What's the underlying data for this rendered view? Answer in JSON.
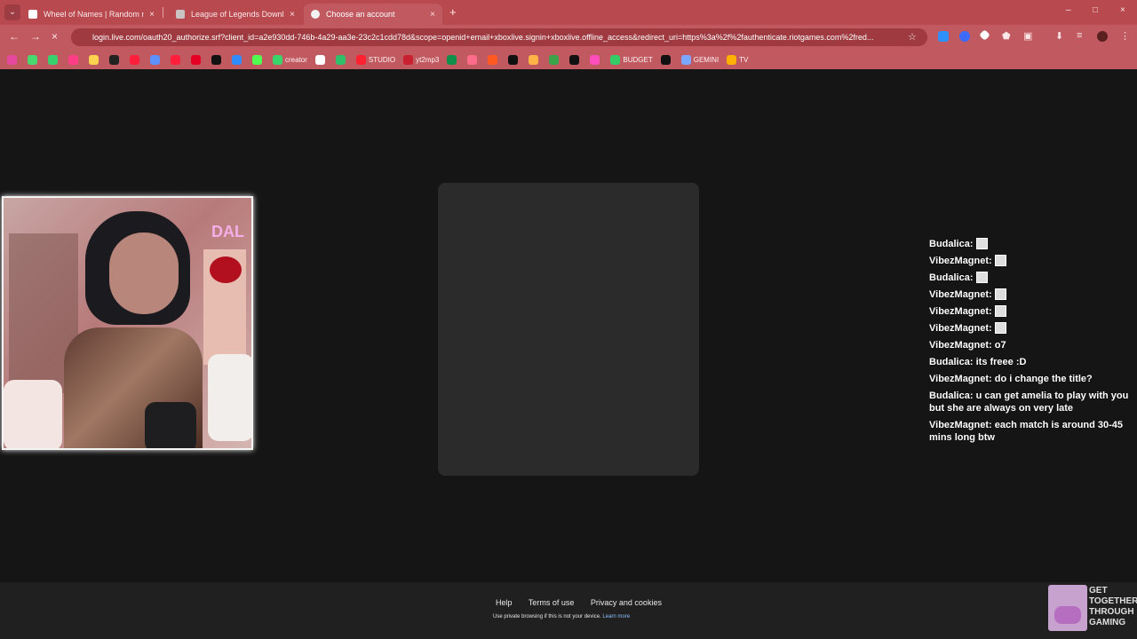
{
  "browser": {
    "tab_list_icon": "chevron-down-icon",
    "tabs": [
      {
        "title": "Wheel of Names | Random nam",
        "favicon_color": "#ffffff",
        "active": false
      },
      {
        "title": "League of Legends Download |",
        "favicon_color": "#c9c3c4",
        "active": false
      },
      {
        "title": "Choose an account",
        "favicon_color": "#f2f2f2",
        "active": true
      }
    ],
    "new_tab_symbol": "+",
    "window_controls": {
      "minimize": "–",
      "maximize": "□",
      "close": "×"
    },
    "toolbar": {
      "back_symbol": "←",
      "forward_symbol": "→",
      "stop_symbol": "×",
      "address": "login.live.com/oauth20_authorize.srf?client_id=a2e930dd-746b-4a29-aa3e-23c2c1cdd78d&scope=openid+email+xboxlive.signin+xboxlive.offline_access&redirect_uri=https%3a%2f%2fauthenticate.riotgames.com%2fred...",
      "site_icon": "tune-icon",
      "bookmark_star": "☆",
      "extensions_icon": "puzzle-icon",
      "downloads_icon": "download-icon",
      "media_icon": "media-icon",
      "profile_icon": "profile-icon",
      "menu_icon": "⋮"
    },
    "bookmarks": [
      {
        "label": "",
        "color": "#e6489f"
      },
      {
        "label": "",
        "color": "#47d86f"
      },
      {
        "label": "",
        "color": "#36d16d"
      },
      {
        "label": "",
        "color": "#ff3d86"
      },
      {
        "label": "",
        "color": "#ffd34e"
      },
      {
        "label": "",
        "color": "#222222"
      },
      {
        "label": "",
        "color": "#ff1f3d"
      },
      {
        "label": "",
        "color": "#5c91ff"
      },
      {
        "label": "",
        "color": "#ff1f3d"
      },
      {
        "label": "",
        "color": "#e60023"
      },
      {
        "label": "",
        "color": "#111111"
      },
      {
        "label": "",
        "color": "#2e8cff"
      },
      {
        "label": "",
        "color": "#50ff50"
      },
      {
        "label": "creator",
        "color": "#39d46a"
      },
      {
        "label": "",
        "color": "#ffffff"
      },
      {
        "label": "",
        "color": "#2fbf68"
      },
      {
        "label": "STUDIO",
        "color": "#ff2030"
      },
      {
        "label": "yt2mp3",
        "color": "#c91f2f"
      },
      {
        "label": "",
        "color": "#0f8f4a"
      },
      {
        "label": "",
        "color": "#ff6b8b"
      },
      {
        "label": "",
        "color": "#ff5a1f"
      },
      {
        "label": "",
        "color": "#111111"
      },
      {
        "label": "",
        "color": "#ffb347"
      },
      {
        "label": "",
        "color": "#3ca34b"
      },
      {
        "label": "",
        "color": "#111111"
      },
      {
        "label": "",
        "color": "#ff4dbb"
      },
      {
        "label": "BUDGET",
        "color": "#33cc66"
      },
      {
        "label": "",
        "color": "#111111"
      },
      {
        "label": "GEMINI",
        "color": "#7aa7ff"
      },
      {
        "label": "TV",
        "color": "#ffb000"
      }
    ]
  },
  "overlay": {
    "camera_label": "DAL",
    "chat": [
      {
        "user": "Budalica",
        "message": "",
        "emote": "emote-icon"
      },
      {
        "user": "VibezMagnet",
        "message": "",
        "emote": "emote-icon"
      },
      {
        "user": "Budalica",
        "message": "",
        "emote": "emote-icon"
      },
      {
        "user": "VibezMagnet",
        "message": "",
        "emote": "emote-icon"
      },
      {
        "user": "VibezMagnet",
        "message": "",
        "emote": "emote-icon"
      },
      {
        "user": "VibezMagnet",
        "message": "",
        "emote": "emote-icon"
      },
      {
        "user": "VibezMagnet",
        "message": "o7",
        "emote": ""
      },
      {
        "user": "Budalica",
        "message": "its freee :D",
        "emote": ""
      },
      {
        "user": "VibezMagnet",
        "message": "do i change the title?",
        "emote": ""
      },
      {
        "user": "Budalica",
        "message": "u can get amelia to play with you but she are always on very late",
        "emote": ""
      },
      {
        "user": "VibezMagnet",
        "message": "each match is around 30-45 mins long btw",
        "emote": ""
      }
    ],
    "branding": {
      "lines": [
        "GET",
        "TOGETHER",
        "THROUGH",
        "GAMING"
      ],
      "icon": "game-controller-icon"
    }
  },
  "footer": {
    "links": [
      "Help",
      "Terms of use",
      "Privacy and cookies"
    ],
    "note_prefix": "Use private browsing if this is not your device.",
    "note_link": "Learn more"
  }
}
